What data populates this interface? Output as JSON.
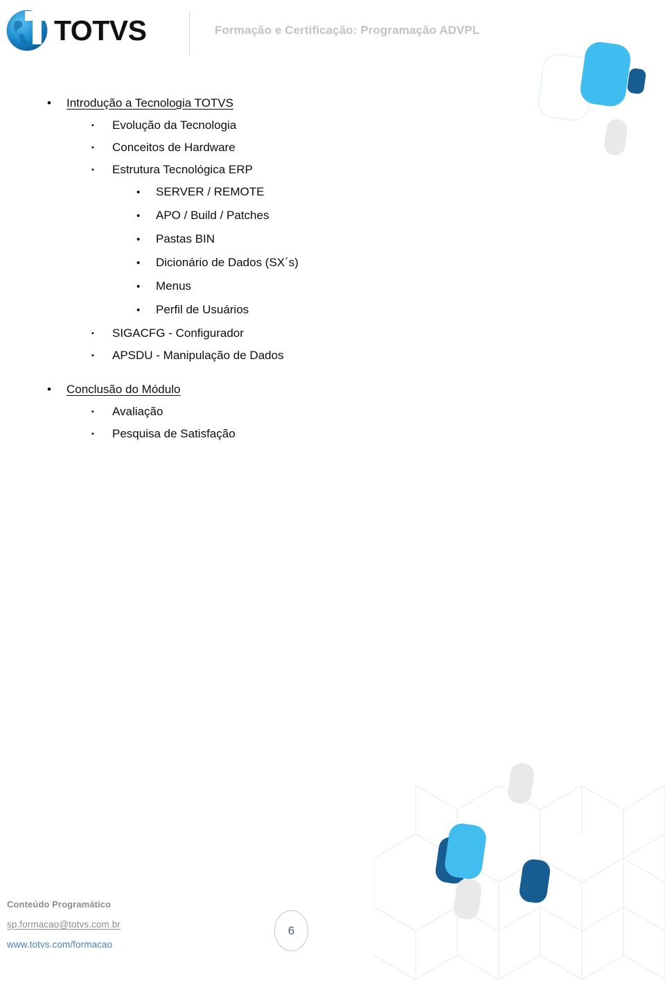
{
  "header": {
    "logo_alt": "TOTVS",
    "wordmark": "TOTVS",
    "title": "Formação e Certificação: Programação ADVPL",
    "title_color": "#c3c3c3"
  },
  "outline": [
    {
      "level": 1,
      "bullet": "•",
      "text": "Introdução a Tecnologia TOTVS",
      "underline": true
    },
    {
      "level": 2,
      "bullet": "▪",
      "text": "Evolução da Tecnologia",
      "underline": false
    },
    {
      "level": 2,
      "bullet": "▪",
      "text": "Conceitos de Hardware",
      "underline": false
    },
    {
      "level": 2,
      "bullet": "▪",
      "text": "Estrutura Tecnológica ERP",
      "underline": false
    },
    {
      "level": 3,
      "bullet": "•",
      "text": "SERVER / REMOTE",
      "underline": false
    },
    {
      "level": 3,
      "bullet": "•",
      "text": "APO / Build / Patches",
      "underline": false
    },
    {
      "level": 3,
      "bullet": "•",
      "text": "Pastas BIN",
      "underline": false
    },
    {
      "level": 3,
      "bullet": "•",
      "text": "Dicionário de Dados (SX´s)",
      "underline": false
    },
    {
      "level": 3,
      "bullet": "•",
      "text": "Menus",
      "underline": false
    },
    {
      "level": 3,
      "bullet": "•",
      "text": "Perfil de Usuários",
      "underline": false
    },
    {
      "level": 2,
      "bullet": "▪",
      "text": "SIGACFG - Configurador",
      "underline": false
    },
    {
      "level": 2,
      "bullet": "▪",
      "text": "APSDU - Manipulação de Dados",
      "underline": false
    },
    {
      "level": 0,
      "bullet": "",
      "text": "",
      "underline": false
    },
    {
      "level": 1,
      "bullet": "•",
      "text": "Conclusão do Módulo",
      "underline": true
    },
    {
      "level": 2,
      "bullet": "▪",
      "text": "Avaliação",
      "underline": false
    },
    {
      "level": 2,
      "bullet": "▪",
      "text": "Pesquisa de Satisfação",
      "underline": false
    }
  ],
  "footer": {
    "title": "Conteúdo Programático",
    "email": "sp.formacao@totvs.com.br",
    "url": "www.totvs.com/formacao",
    "page_number": "6"
  },
  "colors": {
    "brand_cyan": "#3fbdf0",
    "brand_blue": "#1a6aa8",
    "brand_navy": "#175d92",
    "outline_blue": "#d8edfa",
    "gray_shape": "#e6e6e6",
    "grid_line": "#ececec",
    "link_blue": "#4a7fb5",
    "page_circle": "#b9c8d8"
  }
}
